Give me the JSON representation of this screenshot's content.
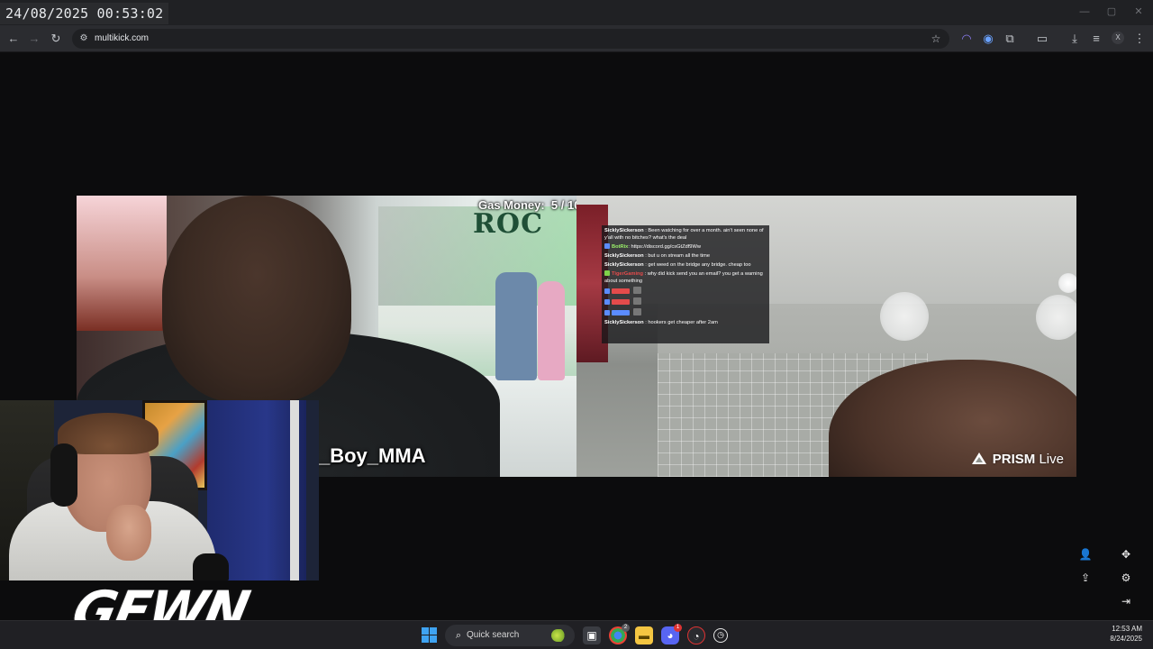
{
  "overlay": {
    "datetime": "24/08/2025 00:53:02"
  },
  "window_controls": {
    "minimize": "—",
    "maximize": "▢",
    "close": "✕"
  },
  "browser": {
    "url": "multikick.com",
    "profile_initial": "X",
    "icons": [
      "back-icon",
      "forward-icon",
      "reload-icon",
      "site-info-icon",
      "bookmark-star-icon",
      "extension-a-icon",
      "extension-b-icon",
      "extensions-puzzle-icon",
      "sidebar-icon",
      "download-icon",
      "media-icon",
      "menu-icon"
    ]
  },
  "streams": {
    "left": {
      "counter": "Gas Money:  5 / 10",
      "streamer_tag": "_Boy_MMA",
      "sign": "ROC"
    },
    "right": {
      "brand": "PRISM",
      "brand_suffix": "Live"
    }
  },
  "chat": {
    "messages": [
      {
        "user": "SicklySickerson",
        "color": "#ffffff",
        "badge": "",
        "text": "Been watching for over a month. ain't seen none of y'all with no bitches? what's the deal"
      },
      {
        "user": "BotRix",
        "color": "#9cf26a",
        "badge": "#5b8cff",
        "text": "https://discord.gg/csGtZdf9Ww"
      },
      {
        "user": "SicklySickerson",
        "color": "#ffffff",
        "badge": "",
        "text": "but u on stream all the time"
      },
      {
        "user": "SicklySickerson",
        "color": "#ffffff",
        "badge": "",
        "text": "get weed on the bridge any bridge. cheap too"
      },
      {
        "user": "TigerGaming",
        "color": "#e44b4b",
        "badge": "#7fd14a",
        "text": "why did kick send you an email? you get a warning about something"
      },
      {
        "user": "",
        "color": "#e44b4b",
        "badge": "#5b8cff",
        "text": ""
      },
      {
        "user": "",
        "color": "#e44b4b",
        "badge": "#5b8cff",
        "text": ""
      },
      {
        "user": "",
        "color": "#5b8cff",
        "badge": "#5b8cff",
        "text": ""
      },
      {
        "user": "SicklySickerson",
        "color": "#ffffff",
        "badge": "",
        "text": "hookers get cheaper after 2am"
      }
    ]
  },
  "webcam": {
    "logo": "GEWN"
  },
  "side_controls": [
    "add-user-icon",
    "move-icon",
    "share-icon",
    "settings-icon",
    "login-icon"
  ],
  "taskbar": {
    "search_label": "Quick search",
    "time": "12:53 AM",
    "date": "8/24/2025",
    "discord_badge": "1",
    "chrome_badge": "2"
  },
  "colors": {
    "background": "#0c0c0d",
    "titlebar": "#202124",
    "toolbar": "#2b2c30",
    "taskbar": "#202024"
  }
}
